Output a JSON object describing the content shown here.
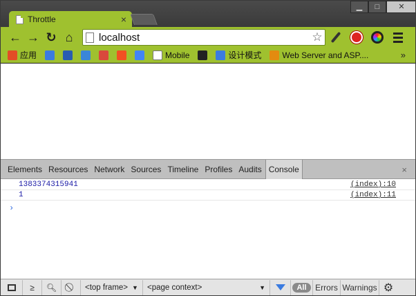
{
  "window": {
    "minimize": "▁",
    "maximize": "□",
    "close": "✕"
  },
  "tab": {
    "title": "Throttle",
    "close": "×"
  },
  "toolbar": {
    "back": "←",
    "forward": "→",
    "reload": "↻",
    "home": "⌂",
    "url": "localhost",
    "star": "☆"
  },
  "bookmarks": {
    "items": [
      {
        "label": "应用",
        "icon": "apps-grid-icon",
        "color": "#e34c26"
      },
      {
        "label": "",
        "icon": "globe-icon",
        "color": "#3b7ce0"
      },
      {
        "label": "",
        "icon": "grid-icon",
        "color": "#2a5db0"
      },
      {
        "label": "",
        "icon": "b-icon",
        "color": "#3a86d8"
      },
      {
        "label": "",
        "icon": "mail-icon",
        "color": "#d9493c"
      },
      {
        "label": "",
        "icon": "windows-icon",
        "color": "#f25022"
      },
      {
        "label": "",
        "icon": "translate-icon",
        "color": "#4285f4"
      },
      {
        "label": "Mobile",
        "icon": "page-icon",
        "color": "#ffffff"
      },
      {
        "label": "",
        "icon": "panda-icon",
        "color": "#222222"
      },
      {
        "label": "设计模式",
        "icon": "globe-icon",
        "color": "#3b7ce0"
      },
      {
        "label": "Web Server and ASP....",
        "icon": "user-icon",
        "color": "#e38b10"
      }
    ],
    "more": "»"
  },
  "devtools": {
    "tabs": [
      "Elements",
      "Resources",
      "Network",
      "Sources",
      "Timeline",
      "Profiles",
      "Audits",
      "Console"
    ],
    "active_tab": "Console",
    "close": "×",
    "console": [
      {
        "message": "1383374315941",
        "source": "(index):10"
      },
      {
        "message": "1",
        "source": "(index):11"
      }
    ],
    "prompt": "›",
    "status": {
      "frame": "<top frame>",
      "context": "<page context>",
      "all": "All",
      "errors": "Errors",
      "warnings": "Warnings"
    }
  }
}
